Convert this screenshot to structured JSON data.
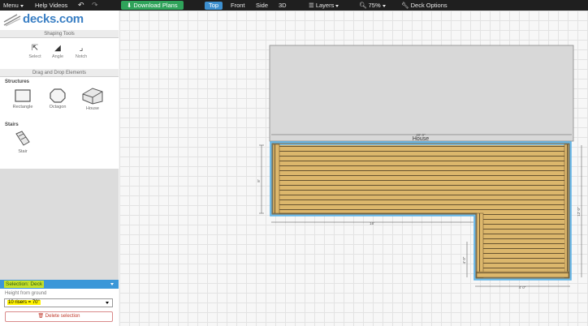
{
  "topbar": {
    "menu_label": "Menu",
    "help_label": "Help Videos",
    "undo_icon": "undo-icon",
    "redo_icon": "redo-icon",
    "download_label": "Download Plans",
    "views": [
      "Top",
      "Front",
      "Side",
      "3D"
    ],
    "active_view": "Top",
    "layers_label": "Layers",
    "zoom_label": "75%",
    "deck_options_label": "Deck Options"
  },
  "sidebar": {
    "logo_text": "decks.com",
    "shaping_tools_title": "Shaping Tools",
    "tools": [
      {
        "label": "Select",
        "icon": "select-cursor-icon"
      },
      {
        "label": "Angle",
        "icon": "angle-icon"
      },
      {
        "label": "Notch",
        "icon": "notch-icon"
      }
    ],
    "drag_drop_title": "Drag and Drop Elements",
    "structures_label": "Structures",
    "structures": [
      {
        "label": "Rectangle",
        "icon": "rectangle-icon"
      },
      {
        "label": "Octagon",
        "icon": "octagon-icon"
      },
      {
        "label": "House",
        "icon": "house-icon"
      }
    ],
    "stairs_label": "Stairs",
    "stairs": [
      {
        "label": "Stair",
        "icon": "stair-icon"
      }
    ]
  },
  "selection": {
    "title": "Selection: Deck",
    "height_label": "Height from ground",
    "height_value": "10 risers = 70\"",
    "delete_label": "Delete selection"
  },
  "plan": {
    "house_label": "House",
    "dim_top": "20' 0\"",
    "dim_left": "8'",
    "dim_bottom": "16'",
    "dim_right": "12' 0\"",
    "dim_notch_side": "4' 0\"",
    "dim_notch_bottom": "4' 0\""
  },
  "colors": {
    "accent": "#3b97d8",
    "download_green": "#2fa35a",
    "deck_wood": "#d9b56a",
    "deck_outline": "#5fb3e6",
    "highlight": "#fff200"
  }
}
